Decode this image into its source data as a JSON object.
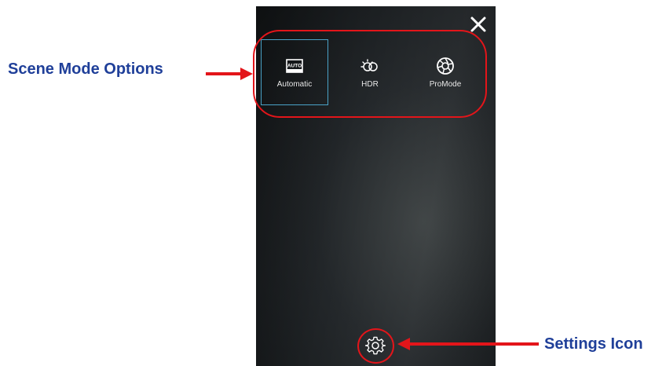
{
  "annotations": {
    "scene_mode_label": "Scene Mode Options",
    "settings_label": "Settings Icon",
    "highlight_color": "#e3151a",
    "text_color": "#1f3f99"
  },
  "camera_ui": {
    "close_icon": "close-icon",
    "scene_modes": [
      {
        "label": "Automatic",
        "icon": "auto-icon",
        "icon_text": "AUTO",
        "selected": true
      },
      {
        "label": "HDR",
        "icon": "hdr-icon",
        "selected": false
      },
      {
        "label": "ProMode",
        "icon": "aperture-icon",
        "selected": false
      }
    ],
    "settings_icon": "gear-icon",
    "selection_color": "#4aa3c8"
  }
}
